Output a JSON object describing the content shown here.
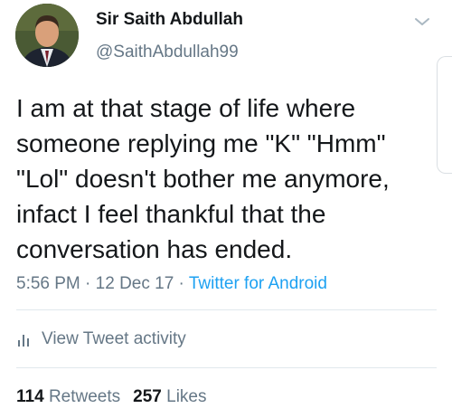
{
  "tweet": {
    "display_name": "Sir Saith Abdullah",
    "handle": "@SaithAbdullah99",
    "text": "I am at that stage of life where\nsomeone replying me \"K\" \"Hmm\"\n\"Lol\" doesn't bother me anymore,\ninfact I feel thankful that the\nconversation has ended.",
    "time": "5:56 PM",
    "separator": " · ",
    "date": "12 Dec 17",
    "source": "Twitter for Android",
    "activity_label": "View Tweet activity",
    "retweets_count": "114",
    "retweets_label": "Retweets",
    "likes_count": "257",
    "likes_label": "Likes"
  },
  "icons": {
    "menu": "chevron-down-icon",
    "activity": "bar-chart-icon"
  },
  "colors": {
    "text": "#14171a",
    "muted": "#657786",
    "accent": "#1da1f2",
    "divider": "#e1e8ed"
  }
}
